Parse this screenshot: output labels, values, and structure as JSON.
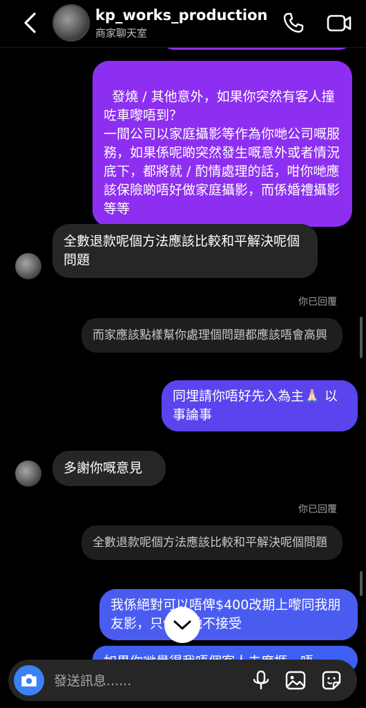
{
  "header": {
    "title": "kp_works_production",
    "subtitle": "商家聊天室"
  },
  "messages": {
    "m1": "發燒 / 其他意外，如果你突然有客人撞咗車嚟唔到？\n一間公司以家庭攝影等作為你哋公司嘅服務，如果係呢啲突然發生嘅意外或者情況底下，都將就 / 酌情處理的話，咁你哋應該保險啲唔好做家庭攝影，而係婚禮攝影等等",
    "m2": "全數退款呢個方法應該比較和平解決呢個問題",
    "m2_meta": "你已回覆",
    "m3_quote": "而家應該點樣幫你處理個問題都應該唔會高興",
    "m3": "同埋請你唔好先入為主🙏🏻 以事論事",
    "m4": "多謝你嘅意見",
    "m4_meta": "你已回覆",
    "m5_quote": "全數退款呢個方法應該比較和平解決呢個問題",
    "m5": "我係絕對可以唔俾$400改期上嚟同我朋友影，只係你哋不接受",
    "m6": "如果你哋覺得我唔個客人去度捱，唔"
  },
  "composer": {
    "placeholder": "發送訊息......"
  },
  "colors": {
    "outgoing_bubble": "#8d2ff0",
    "outgoing_bubble_blue": "#4a5cf0",
    "incoming_bubble": "#262626",
    "accent_blue": "#3b82f6"
  }
}
